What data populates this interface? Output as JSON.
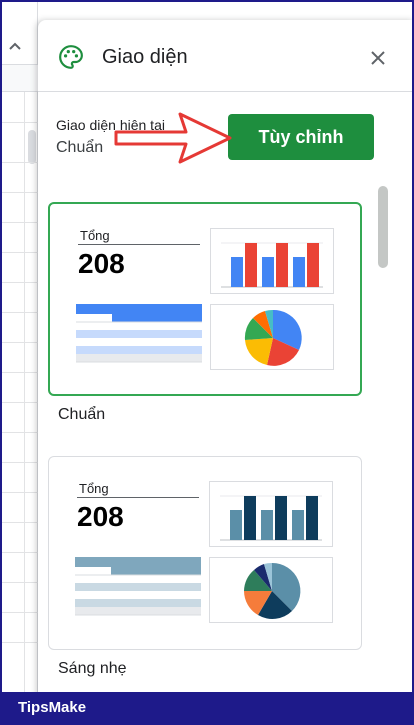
{
  "panel": {
    "title": "Giao diện",
    "current_label": "Giao diện hiện tại",
    "current_value": "Chuẩn",
    "customize_label": "Tùy chỉnh"
  },
  "themes": [
    {
      "name": "Chuẩn",
      "selected": true,
      "total_label": "Tổng",
      "total_value": "208",
      "colors": {
        "bar_a": "#4285f4",
        "bar_b": "#ea4335",
        "table_head": "#4285f4",
        "table_row": "#c6dafc",
        "pie": [
          "#4285f4",
          "#ea4335",
          "#fbbc04",
          "#34a853",
          "#ff6d01",
          "#46bdc6"
        ]
      }
    },
    {
      "name": "Sáng nhẹ",
      "selected": false,
      "total_label": "Tổng",
      "total_value": "208",
      "colors": {
        "bar_a": "#5b8fa8",
        "bar_b": "#0e3c5c",
        "table_head": "#7fa7bd",
        "table_row": "#c9d9e3",
        "pie": [
          "#5b8fa8",
          "#0e3c5c",
          "#f57c3b",
          "#2e7d5b",
          "#1a2b6d",
          "#9bc4d8"
        ]
      }
    }
  ],
  "colors": {
    "accent": "#1e8e3e",
    "selected_border": "#34a853",
    "footer_bg": "#1e1a8a",
    "arrow": "#e53935"
  },
  "footer": {
    "brand": "TipsMake"
  }
}
